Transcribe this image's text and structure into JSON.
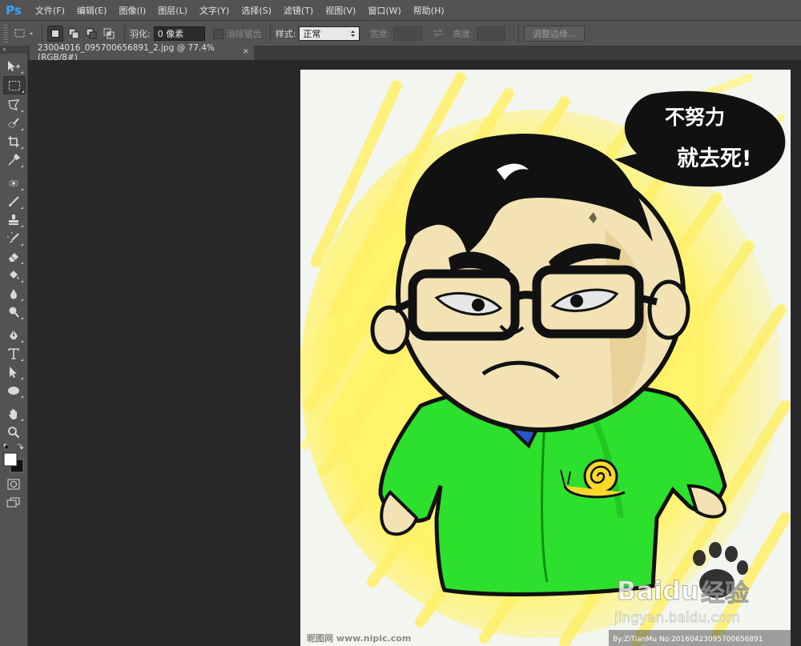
{
  "app": {
    "logo": "Ps"
  },
  "menu": [
    {
      "label": "文件(F)"
    },
    {
      "label": "编辑(E)"
    },
    {
      "label": "图像(I)"
    },
    {
      "label": "图层(L)"
    },
    {
      "label": "文字(Y)"
    },
    {
      "label": "选择(S)"
    },
    {
      "label": "滤镜(T)"
    },
    {
      "label": "视图(V)"
    },
    {
      "label": "窗口(W)"
    },
    {
      "label": "帮助(H)"
    }
  ],
  "options": {
    "feather_label": "羽化:",
    "feather_value": "0 像素",
    "antialias_label": "消除锯齿",
    "style_label": "样式:",
    "style_value": "正常",
    "width_label": "宽度:",
    "height_label": "高度:",
    "refine_edge_label": "调整边缘..."
  },
  "document": {
    "tab_title": "23004016_095700656891_2.jpg @ 77.4%(RGB/8#)",
    "close_glyph": "×"
  },
  "artwork": {
    "speech_line1": "不努力",
    "speech_line2": "就去死!",
    "watermark_baidu": "Baidu",
    "watermark_jingyan_cn": "经验",
    "watermark_site": "jingyan.baidu.com",
    "nipic_mark": "昵图网 www.nipic.com",
    "byline": "By:ZiTianMu No:20160423095700656891"
  },
  "colors": {
    "menubar_bg": "#535353",
    "canvas_bg": "#282828",
    "accent_ps": "#31a8ff",
    "shirt_green": "#2ee02e",
    "collar_blue": "#2a54c8",
    "skin": "#f2e2b4",
    "yellow_bg": "#fff36a"
  }
}
